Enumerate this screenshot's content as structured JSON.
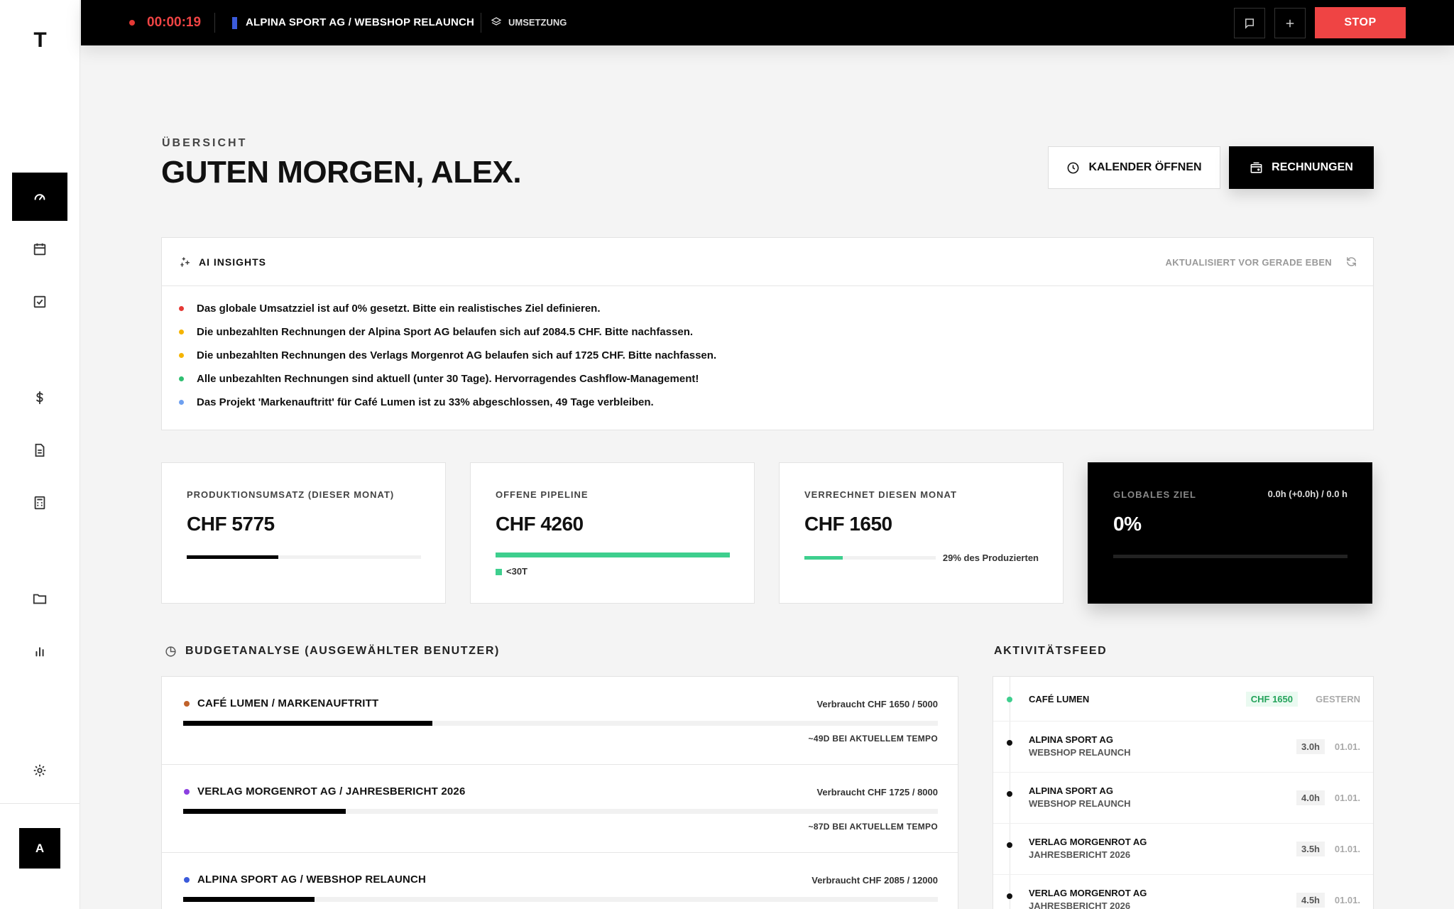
{
  "sidebar": {
    "logo": "T",
    "items": [
      {
        "name": "dashboard",
        "icon": "speedometer-icon",
        "active": true
      },
      {
        "name": "calendar",
        "icon": "calendar-icon"
      },
      {
        "name": "tasks",
        "icon": "checkbox-icon"
      },
      {
        "name": "finance",
        "icon": "dollar-icon"
      },
      {
        "name": "documents",
        "icon": "document-icon"
      },
      {
        "name": "calculator",
        "icon": "calculator-icon"
      },
      {
        "name": "projects",
        "icon": "folder-icon"
      },
      {
        "name": "reports",
        "icon": "bar-chart-icon"
      },
      {
        "name": "settings",
        "icon": "gear-icon"
      }
    ],
    "avatar": "A"
  },
  "topbar": {
    "timer": "00:00:19",
    "project": "ALPINA SPORT AG / WEBSHOP RELAUNCH",
    "phase": "UMSETZUNG",
    "stop_label": "STOP"
  },
  "header": {
    "eyebrow": "ÜBERSICHT",
    "title": "GUTEN MORGEN, ALEX.",
    "calendar_button": "KALENDER ÖFFNEN",
    "invoices_button": "RECHNUNGEN"
  },
  "insights": {
    "title": "AI INSIGHTS",
    "updated": "AKTUALISIERT VOR GERADE EBEN",
    "items": [
      {
        "text": "Das globale Umsatzziel ist auf 0% gesetzt. Bitte ein realistisches Ziel definieren.",
        "color": "#e53935"
      },
      {
        "text": "Die unbezahlten Rechnungen der Alpina Sport AG belaufen sich auf 2084.5 CHF. Bitte nachfassen.",
        "color": "#f5b400"
      },
      {
        "text": "Die unbezahlten Rechnungen des Verlags Morgenrot AG belaufen sich auf 1725 CHF. Bitte nachfassen.",
        "color": "#f5b400"
      },
      {
        "text": "Alle unbezahlten Rechnungen sind aktuell (unter 30 Tage). Hervorragendes Cashflow-Management!",
        "color": "#2fbf71"
      },
      {
        "text": "Das Projekt 'Markenauftritt' für Café Lumen ist zu 33% abgeschlossen, 49 Tage verbleiben.",
        "color": "#6ea0f0"
      }
    ]
  },
  "stats": {
    "production": {
      "label": "PRODUKTIONSUMSATZ (DIESER MONAT)",
      "value": "CHF 5775",
      "progress": 0.39
    },
    "pipeline": {
      "label": "OFFENE PIPELINE",
      "value": "CHF 4260",
      "progress": 1.0,
      "legend": "<30T"
    },
    "billed": {
      "label": "VERRECHNET DIESEN MONAT",
      "value": "CHF 1650",
      "progress": 0.29,
      "note": "29% des Produzierten"
    },
    "goal": {
      "label": "GLOBALES ZIEL",
      "value": "0%",
      "detail": "0.0h (+0.0h) / 0.0 h",
      "progress": 0.0
    }
  },
  "budget": {
    "title": "BUDGETANALYSE (AUSGEWÄHLTER BENUTZER)",
    "rows": [
      {
        "name": "CAFÉ LUMEN / MARKENAUFTRITT",
        "used": "Verbraucht CHF 1650 / 5000",
        "eta": "~49D BEI AKTUELLEM TEMPO",
        "color": "#c0622b",
        "progress": 0.33
      },
      {
        "name": "VERLAG MORGENROT AG / JAHRESBERICHT 2026",
        "used": "Verbraucht CHF 1725 / 8000",
        "eta": "~87D BEI AKTUELLEM TEMPO",
        "color": "#8b3fe0",
        "progress": 0.215
      },
      {
        "name": "ALPINA SPORT AG / WEBSHOP RELAUNCH",
        "used": "Verbraucht CHF 2085 / 12000",
        "eta": "",
        "color": "#3b5bdb",
        "progress": 0.174
      }
    ]
  },
  "feed": {
    "title": "AKTIVITÄTSFEED",
    "items": [
      {
        "title": "CAFÉ LUMEN",
        "sub": "",
        "tag": "CHF 1650",
        "date": "GESTERN",
        "money": true
      },
      {
        "title": "ALPINA SPORT AG",
        "sub": "WEBSHOP RELAUNCH",
        "tag": "3.0h",
        "date": "01.01."
      },
      {
        "title": "ALPINA SPORT AG",
        "sub": "WEBSHOP RELAUNCH",
        "tag": "4.0h",
        "date": "01.01."
      },
      {
        "title": "VERLAG MORGENROT AG",
        "sub": "JAHRESBERICHT 2026",
        "tag": "3.5h",
        "date": "01.01."
      },
      {
        "title": "VERLAG MORGENROT AG",
        "sub": "JAHRESBERICHT 2026",
        "tag": "4.5h",
        "date": "01.01."
      }
    ]
  }
}
